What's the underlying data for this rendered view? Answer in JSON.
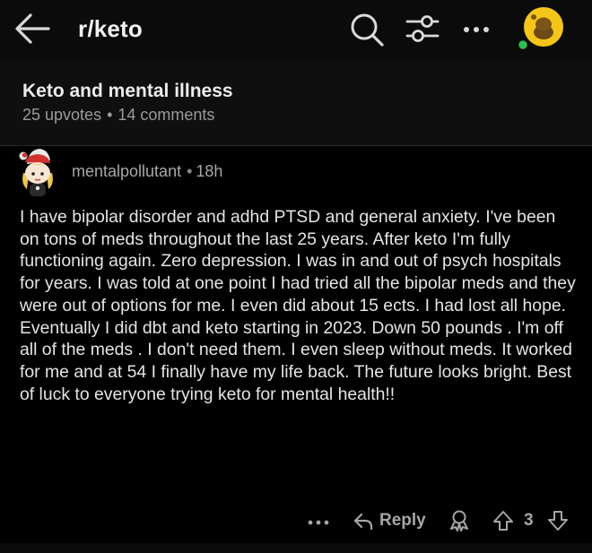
{
  "header": {
    "subreddit": "r/keto",
    "icons": {
      "back": "arrow-left-icon",
      "search": "search-icon",
      "filter": "sliders-icon",
      "more": "more-dots-icon",
      "avatar": "user-avatar-icon"
    }
  },
  "post": {
    "title": "Keto and mental illness",
    "upvotes": "25 upvotes",
    "separator": "•",
    "comments": "14 comments"
  },
  "comment": {
    "author": "mentalpollutant",
    "separator": "•",
    "age": "18h",
    "body": "I have bipolar disorder and adhd   PTSD and general anxiety. I've been on tons of meds throughout the last 25 years. After keto I'm fully functioning again. Zero depression. I was in and out of psych hospitals for years. I was told at one point I had tried all the bipolar meds and they were out of options for me.  I even did about 15 ects. I had lost all hope. Eventually I did dbt and keto starting in 2023. Down 50 pounds . I'm off all of the meds . I don't need them. I even sleep without meds. It worked for me and at 54 I finally have my life back. The future looks bright.  Best of luck to everyone trying keto for mental health!!"
  },
  "actions": {
    "reply_label": "Reply",
    "vote_count": "3",
    "icons": {
      "more": "more-dots-icon",
      "reply": "reply-arrow-icon",
      "award": "award-icon",
      "upvote": "upvote-arrow-icon",
      "downvote": "downvote-arrow-icon"
    }
  },
  "colors": {
    "background": "#000000",
    "header_bg": "#0b0b0b",
    "post_header_bg": "#0f0f0f",
    "text_primary": "#e4e4e4",
    "text_muted": "#9a9a9a",
    "online_dot": "#2fbf4a",
    "avatar_bg": "#f5c518"
  }
}
